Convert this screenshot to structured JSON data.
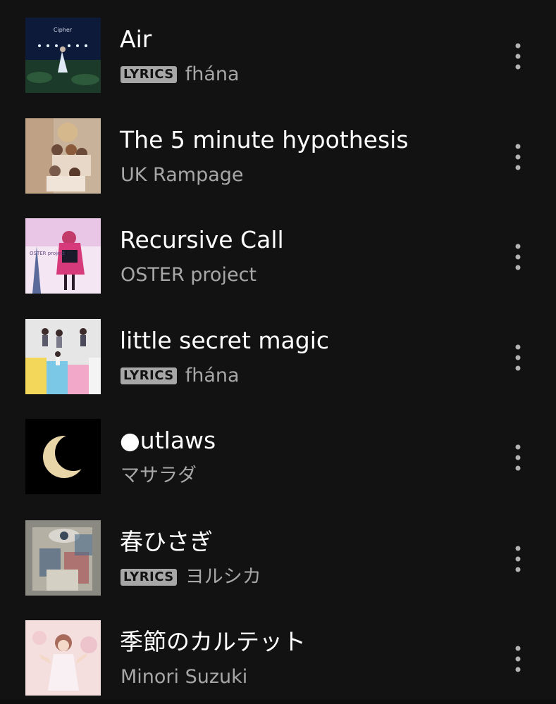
{
  "tracks": [
    {
      "title": "Air",
      "lyrics": true,
      "lyrics_label": "LYRICS",
      "artist": "fhána",
      "art_text": "Cipher",
      "more_icon": "more-vertical-icon"
    },
    {
      "title": "The 5 minute hypothesis",
      "lyrics": false,
      "lyrics_label": "",
      "artist": "UK Rampage",
      "more_icon": "more-vertical-icon"
    },
    {
      "title": "Recursive Call",
      "lyrics": false,
      "lyrics_label": "",
      "artist": "OSTER project",
      "art_text": "OSTER project",
      "more_icon": "more-vertical-icon"
    },
    {
      "title": "little secret magic",
      "lyrics": true,
      "lyrics_label": "LYRICS",
      "artist": "fhána",
      "more_icon": "more-vertical-icon"
    },
    {
      "title": "●utlaws",
      "lyrics": false,
      "lyrics_label": "",
      "artist": "マサラダ",
      "more_icon": "more-vertical-icon"
    },
    {
      "title": "春ひさぎ",
      "lyrics": true,
      "lyrics_label": "LYRICS",
      "artist": "ヨルシカ",
      "more_icon": "more-vertical-icon"
    },
    {
      "title": "季節のカルテット",
      "lyrics": false,
      "lyrics_label": "",
      "artist": "Minori Suzuki",
      "more_icon": "more-vertical-icon"
    }
  ],
  "colors": {
    "background": "#121212",
    "title": "#ffffff",
    "subtitle": "#a7a7a7",
    "badge_bg": "#a7a7a7",
    "badge_text": "#121212"
  }
}
